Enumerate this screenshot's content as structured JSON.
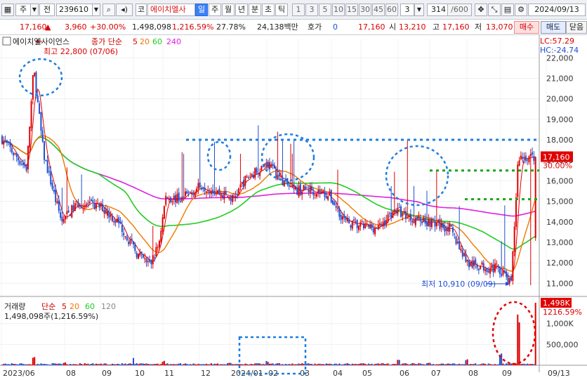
{
  "toolbar": {
    "market": "주",
    "view": "전",
    "code": "239610",
    "name_prefix": "코",
    "name": "에이치엘사",
    "periods": [
      "일",
      "주",
      "월",
      "년",
      "분",
      "초",
      "틱"
    ],
    "selected_period": "일",
    "minutes": [
      "1",
      "3",
      "5",
      "10",
      "15",
      "30",
      "45",
      "60"
    ],
    "custom_minute": "3",
    "count": "314",
    "count_total": "/600",
    "date": "2024/09/13"
  },
  "info": {
    "price": "17,160",
    "change": "3,960",
    "change_pct": "+30.00%",
    "volume": "1,498,098",
    "volume_ratio": "1,216.59%",
    "turnover": "27.78%",
    "amount": "24,138백만",
    "quote_label": "호가",
    "quote_value": "0",
    "quote_price": "17,160",
    "open_label": "시",
    "open": "13,210",
    "high_label": "고",
    "high": "17,160",
    "low_label": "저",
    "low": "13,070",
    "buy": "매수",
    "sell": "매도",
    "close": "닫음"
  },
  "colors": {
    "up": "#e00000",
    "down": "#1f4fd0",
    "ma5": "#e00000",
    "ma20": "#f07800",
    "ma60": "#22cc22",
    "ma240": "#e020e0",
    "annot_blue": "#1d7fe0",
    "annot_green": "#18a818",
    "annot_red": "#e00000"
  },
  "chart_data": [
    {
      "type": "line",
      "title": "에이치엘사이언스",
      "legend_label": "종가 단순",
      "ma_periods": [
        "5",
        "20",
        "60",
        "240"
      ],
      "y_ticks": [
        11000,
        12000,
        13000,
        14000,
        15000,
        16000,
        17000,
        18000,
        19000,
        20000,
        21000,
        22000
      ],
      "x_ticks": [
        "2023/06",
        "08",
        "09",
        "10",
        "11",
        "12",
        "2024/01",
        "02",
        "03",
        "04",
        "05",
        "06",
        "07",
        "08",
        "09",
        "09/13"
      ],
      "ylim": [
        10600,
        22900
      ],
      "corner_labels": [
        "LC:57.29",
        "HC:-24.74"
      ],
      "high_label": "최고 22,800 (07/06)",
      "low_label": "최저 10,910 (09/09)",
      "last_price": "17,160",
      "last_pct": "30.00%",
      "close_anchors": [
        {
          "x": "2023/06",
          "value": 18100
        },
        {
          "x": "06(mid)",
          "value": 17300
        },
        {
          "x": "06(late)",
          "value": 16600
        },
        {
          "x": "07(early)",
          "value": 21500
        },
        {
          "x": "07",
          "value": 17300
        },
        {
          "x": "07(late)",
          "value": 15200
        },
        {
          "x": "08",
          "value": 14000
        },
        {
          "x": "08(mid)",
          "value": 14900
        },
        {
          "x": "09",
          "value": 14700
        },
        {
          "x": "09(late)",
          "value": 13900
        },
        {
          "x": "10",
          "value": 12400
        },
        {
          "x": "10(mid)",
          "value": 11900
        },
        {
          "x": "10(late)",
          "value": 12900
        },
        {
          "x": "11",
          "value": 15200
        },
        {
          "x": "11(mid)",
          "value": 15100
        },
        {
          "x": "12",
          "value": 15800
        },
        {
          "x": "12(late)",
          "value": 15600
        },
        {
          "x": "2024/01",
          "value": 15100
        },
        {
          "x": "01(mid)",
          "value": 16000
        },
        {
          "x": "02",
          "value": 16900
        },
        {
          "x": "02(late)",
          "value": 16100
        },
        {
          "x": "03",
          "value": 15500
        },
        {
          "x": "03(late)",
          "value": 15600
        },
        {
          "x": "04",
          "value": 15300
        },
        {
          "x": "04(late)",
          "value": 14000
        },
        {
          "x": "05",
          "value": 13800
        },
        {
          "x": "05(late)",
          "value": 13700
        },
        {
          "x": "06",
          "value": 14600
        },
        {
          "x": "06(mid)",
          "value": 14200
        },
        {
          "x": "07",
          "value": 14000
        },
        {
          "x": "07(late)",
          "value": 13700
        },
        {
          "x": "08",
          "value": 11900
        },
        {
          "x": "08(late)",
          "value": 11800
        },
        {
          "x": "09",
          "value": 11700
        },
        {
          "x": "09/09",
          "value": 10910
        },
        {
          "x": "09/13",
          "value": 17160
        }
      ],
      "annotations": [
        "resistance ~18,000",
        "levels ~16,500 / ~15,100"
      ]
    },
    {
      "type": "bar",
      "title": "거래량",
      "legend_label": "단순",
      "ma_periods": [
        "5",
        "20",
        "60",
        "120"
      ],
      "value_label": "1,498,098주(1,216.59%)",
      "y_ticks": [
        "500,000",
        "1,000K"
      ],
      "last_value": "1,498K",
      "last_pct": "1216.59%",
      "ylim": [
        0,
        1550000
      ],
      "volume_anchors": [
        {
          "x": "07(early)",
          "value": 220000
        },
        {
          "x": "08",
          "value": 80000
        },
        {
          "x": "10(late)",
          "value": 180000
        },
        {
          "x": "11",
          "value": 140000
        },
        {
          "x": "2024/01",
          "value": 70000
        },
        {
          "x": "02",
          "value": 110000
        },
        {
          "x": "06",
          "value": 150000
        },
        {
          "x": "07",
          "value": 60000
        },
        {
          "x": "08",
          "value": 190000
        },
        {
          "x": "09",
          "value": 320000
        },
        {
          "x": "09/13",
          "value": 1498098
        }
      ]
    }
  ]
}
